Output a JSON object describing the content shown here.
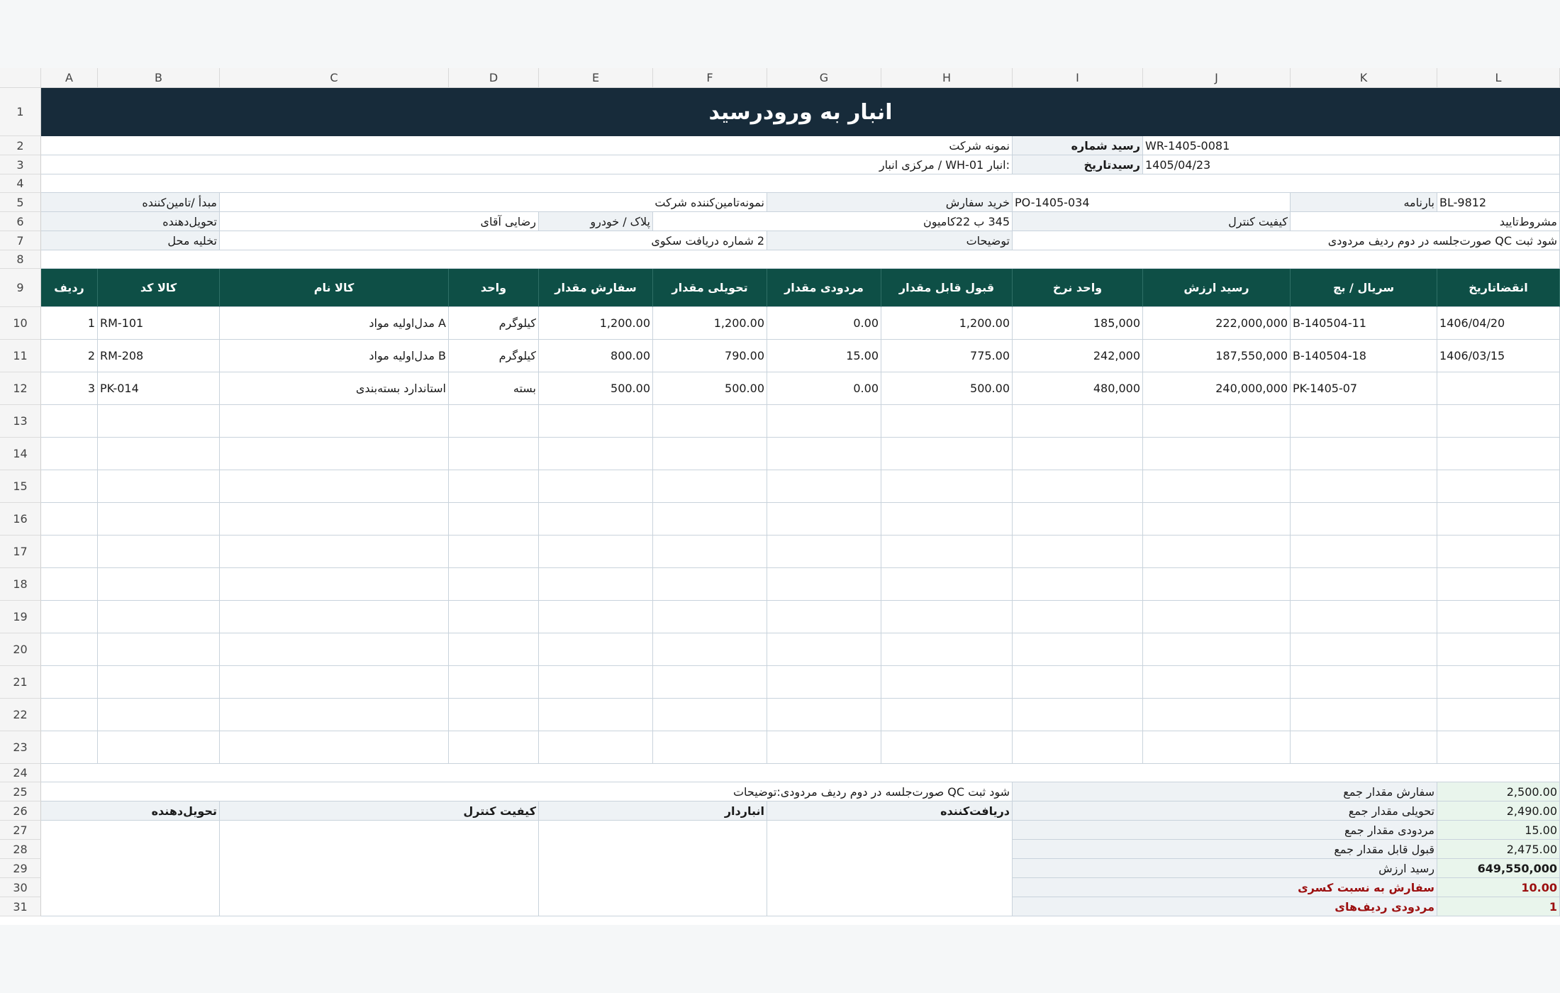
{
  "columns": [
    "A",
    "B",
    "C",
    "D",
    "E",
    "F",
    "G",
    "H",
    "I",
    "J",
    "K",
    "L"
  ],
  "rows": [
    "1",
    "2",
    "3",
    "4",
    "5",
    "6",
    "7",
    "8",
    "9",
    "10",
    "11",
    "12",
    "13",
    "14",
    "15",
    "16",
    "17",
    "18",
    "19",
    "20",
    "21",
    "22",
    "23",
    "24",
    "25",
    "26",
    "27",
    "28",
    "29",
    "30",
    "31"
  ],
  "title": "انبار به ورودرسید",
  "company": "نمونه شرکت",
  "warehouse": ":انبار WH-01 / مرکزی انبار",
  "receipt_no_label": "رسید شماره",
  "receipt_no": "WR-1405-0081",
  "receipt_date_label": "رسیدتاریخ",
  "receipt_date": "1405/04/23",
  "info": {
    "supplier_label": "مبدأ /تامین‌کننده",
    "supplier": "نمونه‌تامین‌کننده شرکت",
    "po_label": "خرید سفارش",
    "po": "PO-1405-034",
    "bl_label": "بارنامه",
    "bl": "BL-9812",
    "deliverer_label": "تحویل‌دهنده",
    "deliverer": "رضایی آقای",
    "plate_label": "پلاک / خودرو",
    "plate": "345 ب 22کامیون",
    "qc_label": "کیفیت کنترل",
    "qc": "مشروط‌تایید",
    "unload_label": "تخلیه محل",
    "unload": "2 شماره دریافت سکوی",
    "notes_label": "توضیحات",
    "notes": "شود ثبت QC صورت‌جلسه در دوم ردیف مردودی"
  },
  "headers": [
    "ردیف",
    "کالا کد",
    "کالا نام",
    "واحد",
    "سفارش مقدار",
    "تحویلی مقدار",
    "مردودی مقدار",
    "قبول قابل مقدار",
    "واحد نرخ",
    "رسید ارزش",
    "سریال / بچ",
    "انقضاتاریخ"
  ],
  "items": [
    {
      "row": "1",
      "code": "RM-101",
      "name": "A مدل‌اولیه مواد",
      "unit": "کیلوگرم",
      "ordered": "1,200.00",
      "delivered": "1,200.00",
      "rejected": "0.00",
      "accepted": "1,200.00",
      "rate": "185,000",
      "value": "222,000,000",
      "batch": "B-140504-11",
      "expiry": "1406/04/20"
    },
    {
      "row": "2",
      "code": "RM-208",
      "name": "B مدل‌اولیه مواد",
      "unit": "کیلوگرم",
      "ordered": "800.00",
      "delivered": "790.00",
      "rejected": "15.00",
      "accepted": "775.00",
      "rate": "242,000",
      "value": "187,550,000",
      "batch": "B-140504-18",
      "expiry": "1406/03/15"
    },
    {
      "row": "3",
      "code": "PK-014",
      "name": "استاندارد بسته‌بندی",
      "unit": "بسته",
      "ordered": "500.00",
      "delivered": "500.00",
      "rejected": "0.00",
      "accepted": "500.00",
      "rate": "480,000",
      "value": "240,000,000",
      "batch": "PK-1405-07",
      "expiry": ""
    }
  ],
  "footer_notes": "شود ثبت QC صورت‌جلسه در دوم ردیف مردودی:توضیحات",
  "signatures": [
    "تحویل‌دهنده",
    "کیفیت کنترل",
    "انباردار",
    "دریافت‌کننده"
  ],
  "totals": [
    {
      "label": "سفارش مقدار جمع",
      "value": "2,500.00"
    },
    {
      "label": "تحویلی مقدار جمع",
      "value": "2,490.00"
    },
    {
      "label": "مردودی مقدار جمع",
      "value": "15.00"
    },
    {
      "label": "قبول قابل مقدار جمع",
      "value": "2,475.00"
    },
    {
      "label": "رسید ارزش",
      "value": "649,550,000"
    },
    {
      "label": "سفارش به نسبت کسری",
      "value": "10.00"
    },
    {
      "label": "مردودی ردیف‌های",
      "value": "1"
    }
  ],
  "colors": {
    "title_bg": "#172b3a",
    "header_bg": "#0e4f46",
    "label_bg": "#eef2f5",
    "total_bg": "#e9f5ec",
    "alert_text": "#9c1010"
  }
}
